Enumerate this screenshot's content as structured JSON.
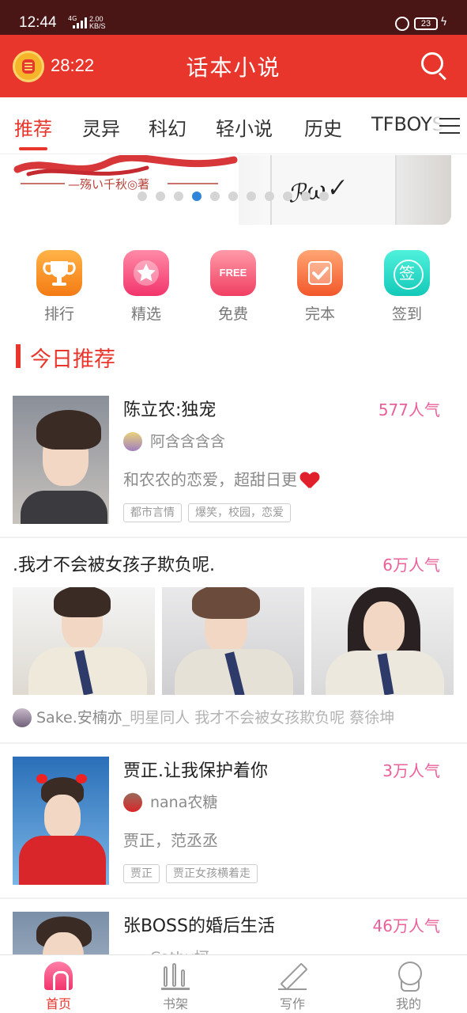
{
  "status_bar": {
    "time": "12:44",
    "network": "4G",
    "speed_value": "2.00",
    "speed_unit": "KB/S",
    "battery": "23"
  },
  "header": {
    "reading_timer": "28:22",
    "title": "话本小说",
    "icons": [
      "alarm-coin-icon",
      "search-icon"
    ],
    "color": "#e8362c"
  },
  "tabs": [
    {
      "label": "推荐",
      "active": true
    },
    {
      "label": "灵异",
      "active": false
    },
    {
      "label": "科幻",
      "active": false
    },
    {
      "label": "轻小说",
      "active": false
    },
    {
      "label": "历史",
      "active": false
    },
    {
      "label": "TFBOYS",
      "active": false
    }
  ],
  "banner": {
    "subtitle": "—殇い千秋◎著",
    "dots_total": 11,
    "dots_active_index": 3
  },
  "quick_entries": [
    {
      "label": "排行",
      "icon": "trophy-icon"
    },
    {
      "label": "精选",
      "icon": "star-icon"
    },
    {
      "label": "免费",
      "icon": "free-icon",
      "icon_text": "FREE"
    },
    {
      "label": "完本",
      "icon": "check-icon"
    },
    {
      "label": "签到",
      "icon": "sign-in-icon",
      "icon_text": "签"
    }
  ],
  "section": {
    "title": "今日推荐"
  },
  "books": [
    {
      "title": "陈立农:独宠",
      "popularity": "577人气",
      "author": "阿含含含含",
      "description": "和农农的恋爱，超甜日更",
      "tags": [
        "都市言情",
        "爆笑，校园，恋爱"
      ]
    },
    {
      "title": ".我才不会被女孩子欺负呢.",
      "popularity": "6万人气",
      "author": "Sake.安楠亦",
      "meta_line": "_明星同人   我才不会被女孩欺负呢   蔡徐坤"
    },
    {
      "title": "贾正.让我保护着你",
      "popularity": "3万人气",
      "author": "nana农糖",
      "description": "贾正，范丞丞",
      "tags": [
        "贾正",
        "贾正女孩横着走"
      ]
    },
    {
      "title": "张BOSS的婚后生活",
      "popularity": "46万人气",
      "author": "Cathy坷"
    }
  ],
  "bottom_nav": [
    {
      "label": "首页",
      "icon": "home-icon",
      "active": true
    },
    {
      "label": "书架",
      "icon": "bookshelf-icon",
      "active": false
    },
    {
      "label": "写作",
      "icon": "pen-icon",
      "active": false
    },
    {
      "label": "我的",
      "icon": "profile-icon",
      "active": false
    }
  ]
}
